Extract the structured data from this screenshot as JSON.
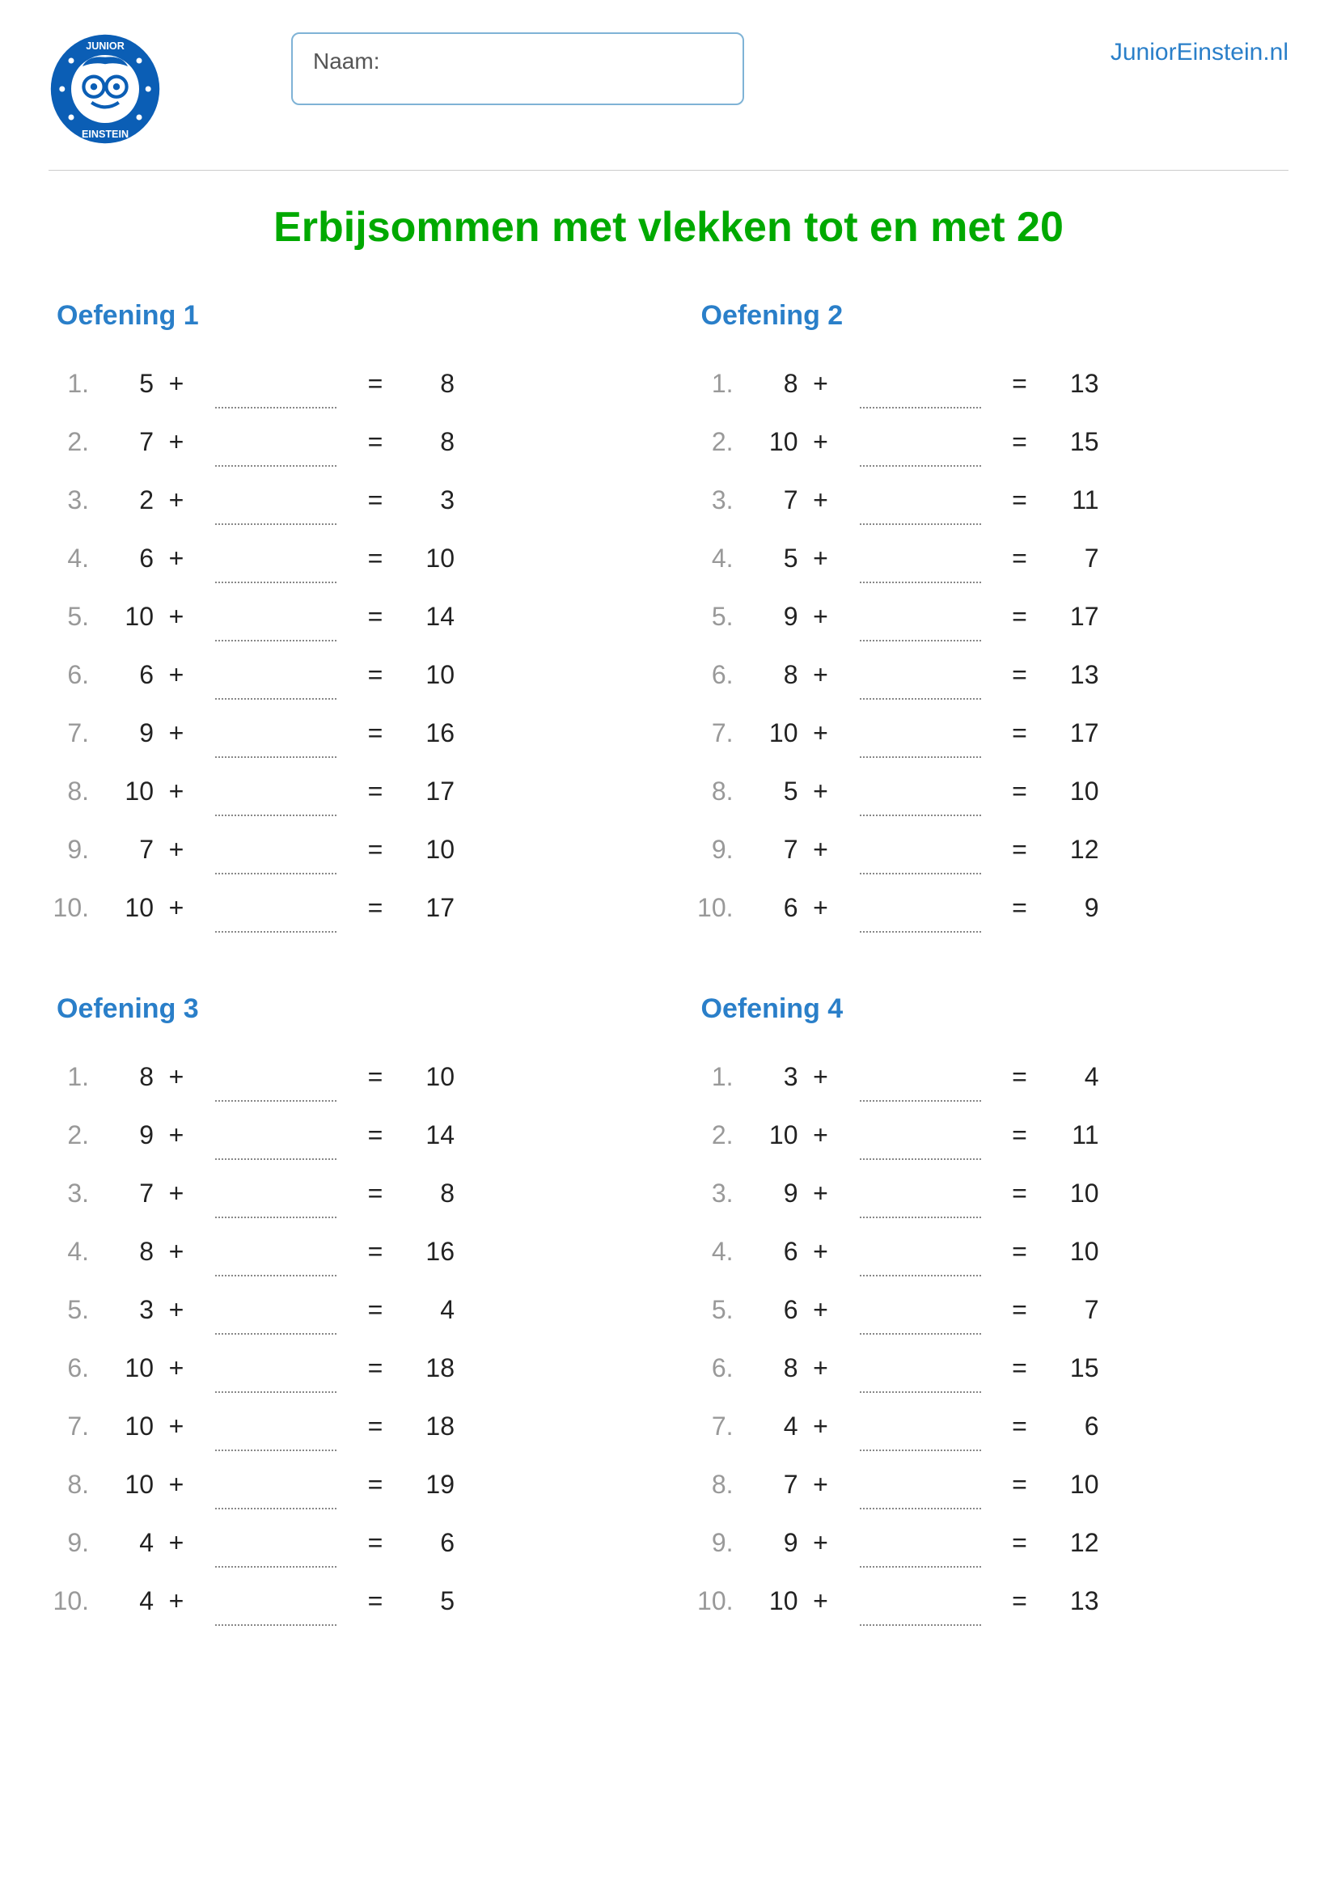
{
  "header": {
    "name_label": "Naam:",
    "site": "JuniorEinstein.nl",
    "logo_text_top": "JUNIOR",
    "logo_text_bottom": "EINSTEIN"
  },
  "title": "Erbijsommen met vlekken tot en met 20",
  "exercise_label_prefix": "Oefening",
  "operator": "+",
  "equals": "=",
  "exercises": [
    {
      "number": 1,
      "problems": [
        {
          "a": 5,
          "result": 8
        },
        {
          "a": 7,
          "result": 8
        },
        {
          "a": 2,
          "result": 3
        },
        {
          "a": 6,
          "result": 10
        },
        {
          "a": 10,
          "result": 14
        },
        {
          "a": 6,
          "result": 10
        },
        {
          "a": 9,
          "result": 16
        },
        {
          "a": 10,
          "result": 17
        },
        {
          "a": 7,
          "result": 10
        },
        {
          "a": 10,
          "result": 17
        }
      ]
    },
    {
      "number": 2,
      "problems": [
        {
          "a": 8,
          "result": 13
        },
        {
          "a": 10,
          "result": 15
        },
        {
          "a": 7,
          "result": 11
        },
        {
          "a": 5,
          "result": 7
        },
        {
          "a": 9,
          "result": 17
        },
        {
          "a": 8,
          "result": 13
        },
        {
          "a": 10,
          "result": 17
        },
        {
          "a": 5,
          "result": 10
        },
        {
          "a": 7,
          "result": 12
        },
        {
          "a": 6,
          "result": 9
        }
      ]
    },
    {
      "number": 3,
      "problems": [
        {
          "a": 8,
          "result": 10
        },
        {
          "a": 9,
          "result": 14
        },
        {
          "a": 7,
          "result": 8
        },
        {
          "a": 8,
          "result": 16
        },
        {
          "a": 3,
          "result": 4
        },
        {
          "a": 10,
          "result": 18
        },
        {
          "a": 10,
          "result": 18
        },
        {
          "a": 10,
          "result": 19
        },
        {
          "a": 4,
          "result": 6
        },
        {
          "a": 4,
          "result": 5
        }
      ]
    },
    {
      "number": 4,
      "problems": [
        {
          "a": 3,
          "result": 4
        },
        {
          "a": 10,
          "result": 11
        },
        {
          "a": 9,
          "result": 10
        },
        {
          "a": 6,
          "result": 10
        },
        {
          "a": 6,
          "result": 7
        },
        {
          "a": 8,
          "result": 15
        },
        {
          "a": 4,
          "result": 6
        },
        {
          "a": 7,
          "result": 10
        },
        {
          "a": 9,
          "result": 12
        },
        {
          "a": 10,
          "result": 13
        }
      ]
    }
  ]
}
